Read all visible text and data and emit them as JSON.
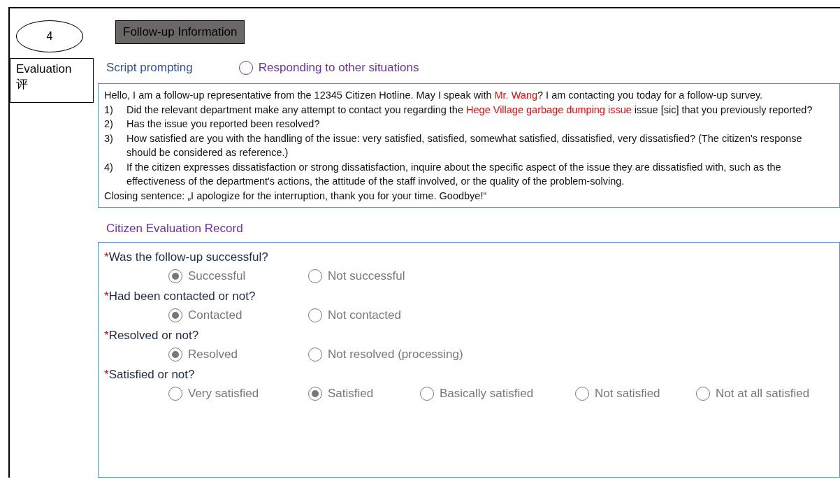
{
  "step": "4",
  "section_title": "Follow-up Information",
  "sidebar": {
    "label": "Evaluation",
    "label_cn": "评"
  },
  "script_title": "Script prompting",
  "other_option": {
    "label": "Responding to other situations",
    "selected": false
  },
  "script": {
    "greeting": [
      {
        "text": "Hello, I am a follow-up representative from the 12345 Citizen Hotline. May I speak with ",
        "highlight": false
      },
      {
        "text": "Mr. Wang",
        "highlight": true
      },
      {
        "text": "? I am contacting you today for a follow-up survey.",
        "highlight": false
      }
    ],
    "items": [
      {
        "number": "1)",
        "segments": [
          {
            "text": "Did the relevant department make any attempt to contact you regarding the ",
            "highlight": false
          },
          {
            "text": "Hege Village garbage dumping issue",
            "highlight": true
          },
          {
            "text": " issue [sic] that you previously reported?",
            "highlight": false
          }
        ]
      },
      {
        "number": "2)",
        "segments": [
          {
            "text": "Has the issue you reported been resolved?",
            "highlight": false
          }
        ]
      },
      {
        "number": "3)",
        "segments": [
          {
            "text": "How satisfied are you with the handling of the issue: very satisfied, satisfied, somewhat satisfied, dissatisfied, very dissatisfied? (The citizen's response should be considered as reference.)",
            "highlight": false
          }
        ]
      },
      {
        "number": "4)",
        "segments": [
          {
            "text": "If the citizen expresses dissatisfaction or strong dissatisfaction, inquire about the specific aspect of the issue they are dissatisfied with, such as the effectiveness of the department's actions, the attitude of the staff involved, or the quality of the problem-solving.",
            "highlight": false
          }
        ]
      }
    ],
    "closing": "Closing sentence: „I apologize for the interruption, thank you for your time. Goodbye!“"
  },
  "record_title": "Citizen Evaluation Record",
  "questions": [
    {
      "marker": "*",
      "label": "Was the follow-up successful?",
      "options": [
        {
          "label": "Successful",
          "selected": true
        },
        {
          "label": "Not successful",
          "selected": false
        }
      ]
    },
    {
      "marker": "*",
      "label": "Had been contacted or not?",
      "options": [
        {
          "label": "Contacted",
          "selected": true
        },
        {
          "label": "Not contacted",
          "selected": false
        }
      ]
    },
    {
      "marker": "*",
      "label": "Resolved or not?",
      "options": [
        {
          "label": "Resolved",
          "selected": true
        },
        {
          "label": "Not resolved (processing)",
          "selected": false
        }
      ]
    },
    {
      "marker": "*",
      "label": "Satisfied or not?",
      "options": [
        {
          "label": "Very satisfied",
          "selected": false
        },
        {
          "label": "Satisfied",
          "selected": true
        },
        {
          "label": "Basically satisfied",
          "selected": false
        },
        {
          "label": "Not satisfied",
          "selected": false
        },
        {
          "label": "Not at all satisfied",
          "selected": false
        }
      ]
    }
  ]
}
